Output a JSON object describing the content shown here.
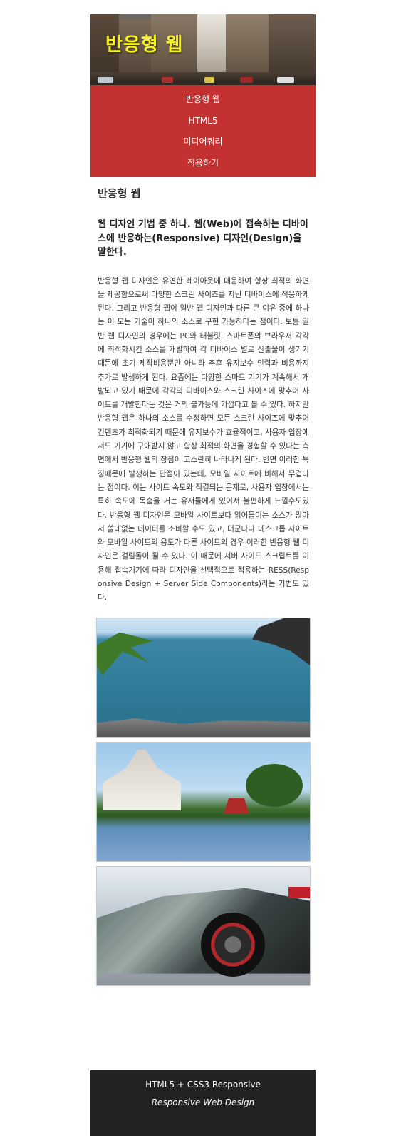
{
  "header": {
    "title": "반응형 웹"
  },
  "nav": {
    "items": [
      "반응형 웹",
      "HTML5",
      "미디어쿼리",
      "적용하기"
    ]
  },
  "article": {
    "heading": "반응형 웹",
    "subheading": "웹 디자인 기법 중 하나. 웹(Web)에 접속하는 디바이스에 반응하는(Responsive) 디자인(Design)을 말한다.",
    "body": "반응형 웹 디자인은 유연한 레이아웃에 대응하여 항상 최적의 화면을 제공함으로써 다양한 스크린 사이즈를 지닌 디바이스에 적응하게 된다. 그리고 반응형 웹이 일반 웹 디자인과 다른 큰 이유 중에 하나는 이 모든 기술이 하나의 소스로 구현 가능하다는 점이다. 보통 일반 웹 디자인의 경우에는 PC와 태블릿, 스마트폰의 브라우저 각각에 최적화시킨 소스를 개발하여 각 디바이스 별로 산출물이 생기기 때문에 초기 제작비용뿐만 아니라 추후 유지보수 인력과 비용까지 추가로 발생하게 된다. 요즘에는 다양한 스마트 기기가 계속해서 개발되고 있기 때문에 각각의 디바이스와 스크린 사이즈에 맞추어 사이트를 개발한다는 것은 거의 불가능에 가깝다고 볼 수 있다. 하지만 반응형 웹은 하나의 소스를 수정하면 모든 스크린 사이즈에 맞추어 컨텐츠가 최적화되기 때문에 유지보수가 효율적이고, 사용자 입장에서도 기기에 구애받지 않고 항상 최적의 화면을 경험할 수 있다는 측면에서 반응형 웹의 장점이 고스란히 나타나게 된다. 반면 이러한 특징때문에 발생하는 단점이 있는데, 모바일 사이트에 비해서 무겁다는 점이다. 이는 사이트 속도와 직결되는 문제로, 사용자 입장에서는 특히 속도에 목숨을 거는 유저들에게 있어서 불편하게 느낄수도있다. 반응형 웹 디자인은 모바일 사이트보다 읽어들이는 소스가 많아서 쓸데없는 데이터를 소비할 수도 있고, 더군다나 데스크톱 사이트와 모바일 사이트의 용도가 다른 사이트의 경우 이러한 반응형 웹 디자인은 걸림돌이 될 수 있다. 이 때문에 서버 사이드 스크립트를 이용해 접속기기에 따라 디자인을 선택적으로 적용하는 RESS(Responsive Design + Server Side Components)라는 기법도 있다."
  },
  "footer": {
    "line1": "HTML5 + CSS3 Responsive",
    "line2": "Responsive Web Design"
  },
  "colors": {
    "nav_bg": "#c43131",
    "title": "#f7f01c",
    "footer_bg": "#222222"
  }
}
